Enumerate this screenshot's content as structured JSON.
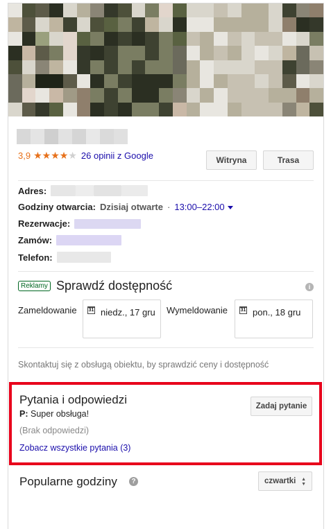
{
  "place": {
    "rating": "3,9",
    "stars_filled": 4,
    "stars_total": 5,
    "reviews_link": "26 opinii z Google",
    "website_button": "Witryna",
    "route_button": "Trasa"
  },
  "info": {
    "address_label": "Adres:",
    "hours_label": "Godziny otwarcia:",
    "hours_status": "Dzisiaj otwarte",
    "hours_separator": "·",
    "hours_range": "13:00–22:00",
    "reservation_label": "Rezerwacje:",
    "order_label": "Zamów:",
    "phone_label": "Telefon:"
  },
  "availability": {
    "ad_badge": "Reklamy",
    "title": "Sprawdź dostępność",
    "checkin_label": "Zameldowanie",
    "checkin_date": "niedz., 17 gru",
    "checkout_label": "Wymeldowanie",
    "checkout_date": "pon., 18 gru",
    "contact_note": "Skontaktuj się z obsługą obiektu, by sprawdzić ceny i dostępność"
  },
  "qa": {
    "title": "Pytania i odpowiedzi",
    "ask_button": "Zadaj pytanie",
    "question_prefix": "P:",
    "question_text": "Super obsługa!",
    "no_answers": "(Brak odpowiedzi)",
    "see_all_link": "Zobacz wszystkie pytania (3)"
  },
  "popular": {
    "title": "Popularne godziny",
    "day_selected": "czwartki"
  },
  "icons": {
    "calendar_icon_text": "31",
    "info_icon": "info-icon",
    "help_icon": "help-icon"
  },
  "colors": {
    "link": "#1a0dab",
    "rating": "#e7711b",
    "highlight_border": "#e8001b",
    "ad_green": "#006621"
  }
}
